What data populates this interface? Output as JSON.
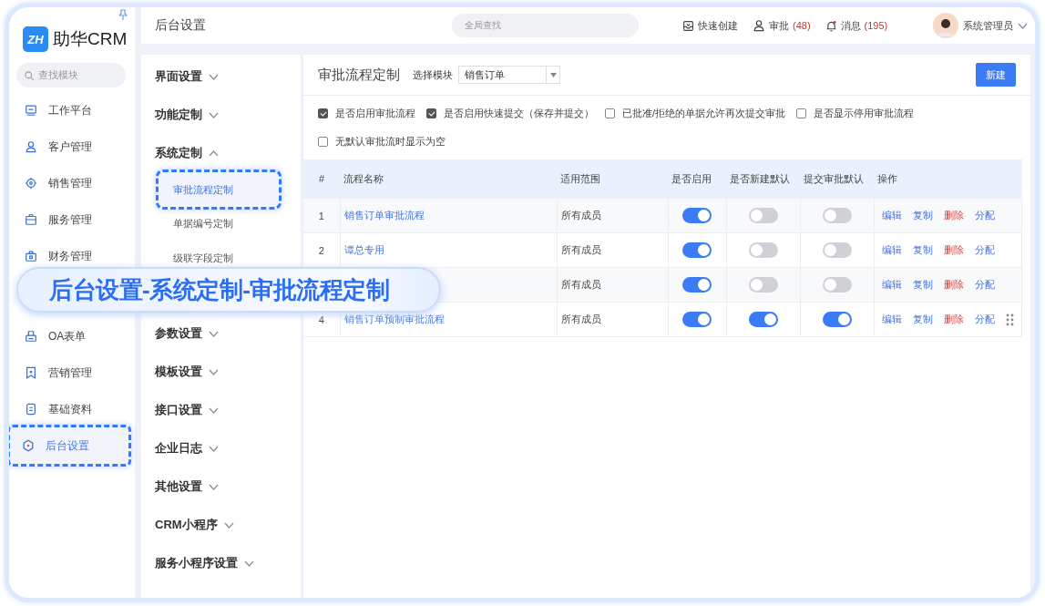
{
  "brand": {
    "logo_mark": "ZH",
    "name": "助华CRM"
  },
  "sidebar": {
    "search": {
      "placeholder": "查找模块"
    },
    "items": [
      {
        "label": "工作平台",
        "kind": "monitor",
        "selected": false
      },
      {
        "label": "客户管理",
        "kind": "person",
        "selected": false
      },
      {
        "label": "销售管理",
        "kind": "target",
        "selected": false
      },
      {
        "label": "服务管理",
        "kind": "briefcase",
        "selected": false
      },
      {
        "label": "财务管理",
        "kind": "safe",
        "selected": false
      },
      {
        "label": "OA表单",
        "kind": "printer",
        "selected": false
      },
      {
        "label": "营销管理",
        "kind": "bookmark",
        "selected": false
      },
      {
        "label": "基础资料",
        "kind": "document",
        "selected": false
      },
      {
        "label": "后台设置",
        "kind": "gear",
        "selected": true
      }
    ]
  },
  "header": {
    "title": "后台设置",
    "search": {
      "placeholder": "全局查找"
    },
    "actions": [
      {
        "label": "快速创建",
        "kind": "inbox"
      },
      {
        "label": "审批",
        "kind": "person",
        "count": "(48)"
      },
      {
        "label": "消息",
        "kind": "bell",
        "count": "(195)"
      }
    ],
    "user": "系统管理员"
  },
  "submenu": [
    {
      "label": "界面设置",
      "expanded": false
    },
    {
      "label": "功能定制",
      "expanded": false
    },
    {
      "label": "系统定制",
      "expanded": true,
      "children": [
        {
          "label": "审批流程定制",
          "selected": true
        },
        {
          "label": "单据编号定制",
          "selected": false
        },
        {
          "label": "级联字段定制",
          "selected": false
        }
      ]
    },
    {
      "label": "参数设置",
      "expanded": false
    },
    {
      "label": "模板设置",
      "expanded": false
    },
    {
      "label": "接口设置",
      "expanded": false
    },
    {
      "label": "企业日志",
      "expanded": false
    },
    {
      "label": "其他设置",
      "expanded": false
    },
    {
      "label": "CRM小程序",
      "expanded": false
    },
    {
      "label": "服务小程序设置",
      "expanded": false
    }
  ],
  "main": {
    "title": "审批流程定制",
    "module_label": "选择模块",
    "module_value": "销售订单",
    "new_button": "新建",
    "options": [
      {
        "label": "是否启用审批流程",
        "checked": true
      },
      {
        "label": "是否启用快速提交（保存并提交）",
        "checked": true
      },
      {
        "label": "已批准/拒绝的单据允许再次提交审批",
        "checked": false
      },
      {
        "label": "是否显示停用审批流程",
        "checked": false
      },
      {
        "label": "无默认审批流时显示为空",
        "checked": false
      }
    ],
    "table": {
      "columns": [
        "#",
        "流程名称",
        "适用范围",
        "是否启用",
        "是否新建默认",
        "提交审批默认",
        "操作"
      ],
      "rows": [
        {
          "number": "1",
          "name": "销售订单审批流程",
          "scope": "所有成员",
          "enabled": true,
          "new_default": false,
          "submit_default": false,
          "actions": [
            {
              "label": "编辑",
              "kind": "normal"
            },
            {
              "label": "复制",
              "kind": "normal"
            },
            {
              "label": "删除",
              "kind": "danger"
            },
            {
              "label": "分配",
              "kind": "normal"
            }
          ]
        },
        {
          "number": "2",
          "name": "谭总专用",
          "scope": "所有成员",
          "enabled": true,
          "new_default": false,
          "submit_default": false,
          "actions": [
            {
              "label": "编辑",
              "kind": "normal"
            },
            {
              "label": "复制",
              "kind": "normal"
            },
            {
              "label": "删除",
              "kind": "danger"
            },
            {
              "label": "分配",
              "kind": "normal"
            }
          ]
        },
        {
          "scope": "所有成员",
          "enabled": true,
          "new_default": false,
          "submit_default": false,
          "actions": [
            {
              "label": "编辑",
              "kind": "normal"
            },
            {
              "label": "复制",
              "kind": "normal"
            },
            {
              "label": "删除",
              "kind": "danger"
            },
            {
              "label": "分配",
              "kind": "normal"
            }
          ]
        },
        {
          "number": "4",
          "name": "销售订单预制审批流程",
          "scope": "所有成员",
          "enabled": true,
          "new_default": true,
          "submit_default": true,
          "drag_handle": true,
          "actions": [
            {
              "label": "编辑",
              "kind": "normal"
            },
            {
              "label": "复制",
              "kind": "normal"
            },
            {
              "label": "删除",
              "kind": "danger"
            },
            {
              "label": "分配",
              "kind": "normal"
            }
          ]
        }
      ]
    }
  },
  "banner": {
    "text": "后台设置-系统定制-审批流程定制"
  }
}
